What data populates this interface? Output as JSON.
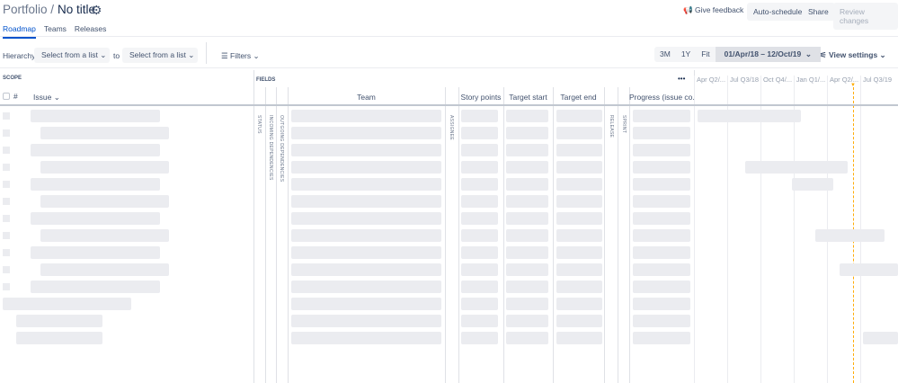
{
  "header": {
    "breadcrumb": "Portfolio /",
    "title": "No title",
    "feedback": "Give feedback",
    "auto_schedule": "Auto-schedule",
    "share": "Share",
    "review": "Review changes"
  },
  "tabs": [
    "Roadmap",
    "Teams",
    "Releases"
  ],
  "toolbar": {
    "hierarchy_label": "Hierarchy:",
    "from_value": "Select from a list",
    "to_label": "to",
    "to_value": "Select from a list",
    "filters": "Filters",
    "zoom": [
      "3M",
      "1Y",
      "Fit"
    ],
    "range": "01/Apr/18 – 12/Oct/19",
    "view_settings": "View settings"
  },
  "scope": {
    "label": "SCOPE",
    "hash": "#",
    "issue": "Issue"
  },
  "fields": {
    "label": "FIELDS",
    "more": "•••",
    "columns": {
      "status": "STATUS",
      "incoming": "INCOMING DEPENDENCIES",
      "outgoing": "OUTGOING DEPENDENCIES",
      "team": "Team",
      "assignee": "ASSIGNEE",
      "story_points": "Story points",
      "target_start": "Target start",
      "target_end": "Target end",
      "release": "RELEASE",
      "sprint": "SPRINT",
      "progress": "Progress (issue co..."
    }
  },
  "timeline": {
    "quarters": [
      "Apr Q2/...",
      "Jul Q3/18",
      "Oct Q4/...",
      "Jan Q1/...",
      "Apr Q2/...",
      "Jul Q3/19"
    ],
    "today_color": "#ffab00"
  }
}
